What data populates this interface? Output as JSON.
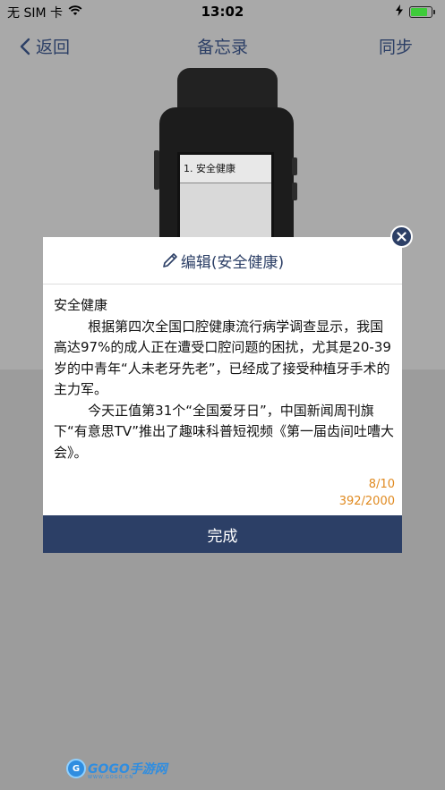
{
  "status_bar": {
    "carrier": "无 SIM 卡",
    "time": "13:02",
    "battery_level": 0.8,
    "battery_color": "#3ecb3a"
  },
  "nav": {
    "back_label": "返回",
    "title": "备忘录",
    "sync_label": "同步"
  },
  "watch": {
    "item_1": "1. 安全健康"
  },
  "modal": {
    "header_title": "编辑(安全健康)",
    "content": "安全健康\n        根据第四次全国口腔健康流行病学调查显示，我国高达97%的成人正在遭受口腔问题的困扰，尤其是20-39岁的中青年“人未老牙先老”，已经成了接受种植牙手术的主力军。\n        今天正值第31个“全国爱牙日”，中国新闻周刊旗下“有意思TV”推出了趣味科普短视频《第一届齿间吐嘈大会》。",
    "count_items": "8/10",
    "count_chars": "392/2000",
    "done_label": "完成"
  },
  "watermark": {
    "brand": "GOGO手游网",
    "url": "WWW.GOGO.CN"
  },
  "colors": {
    "accent": "#2c3f66",
    "count_color": "#e08a20"
  }
}
